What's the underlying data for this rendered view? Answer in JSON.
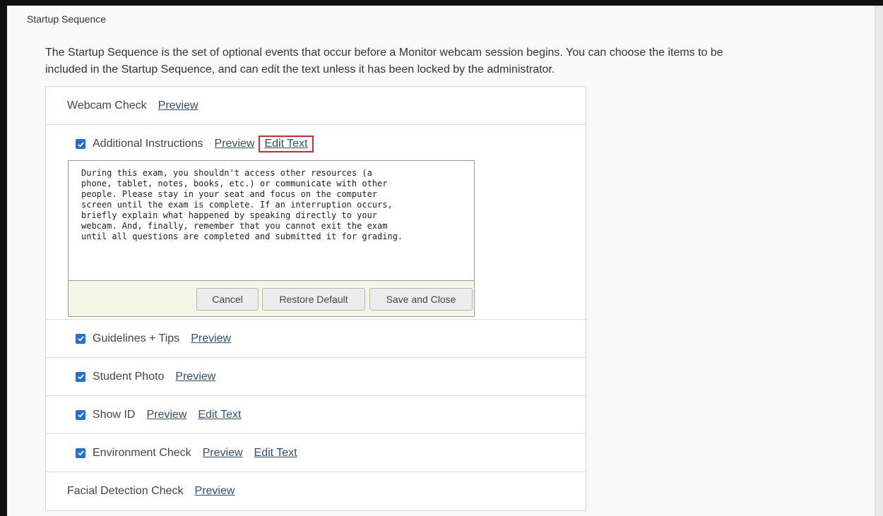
{
  "section_title": "Startup Sequence",
  "description": "The Startup Sequence is the set of optional events that occur before a Monitor webcam session begins. You can choose the items to be included in the Startup Sequence, and can edit the text unless it has been locked by the administrator.",
  "items": [
    {
      "label": "Webcam Check",
      "preview": "Preview"
    },
    {
      "label": "Additional Instructions",
      "preview": "Preview",
      "edit": "Edit Text",
      "checked": true
    },
    {
      "label": "Guidelines + Tips",
      "preview": "Preview",
      "checked": true
    },
    {
      "label": "Student Photo",
      "preview": "Preview",
      "checked": true
    },
    {
      "label": "Show ID",
      "preview": "Preview",
      "edit": "Edit Text",
      "checked": true
    },
    {
      "label": "Environment Check",
      "preview": "Preview",
      "edit": "Edit Text",
      "checked": true
    },
    {
      "label": "Facial Detection Check",
      "preview": "Preview"
    }
  ],
  "editor": {
    "text": "During this exam, you shouldn't access other resources (a\nphone, tablet, notes, books, etc.) or communicate with other\npeople. Please stay in your seat and focus on the computer\nscreen until the exam is complete. If an interruption occurs,\nbriefly explain what happened by speaking directly to your\nwebcam. And, finally, remember that you cannot exit the exam\nuntil all questions are completed and submitted it for grading.",
    "cancel": "Cancel",
    "restore": "Restore Default",
    "save": "Save and Close"
  },
  "colors": {
    "checkbox": "#1e6fd6",
    "highlight": "#d9272e",
    "link": "#2f4f6f"
  }
}
